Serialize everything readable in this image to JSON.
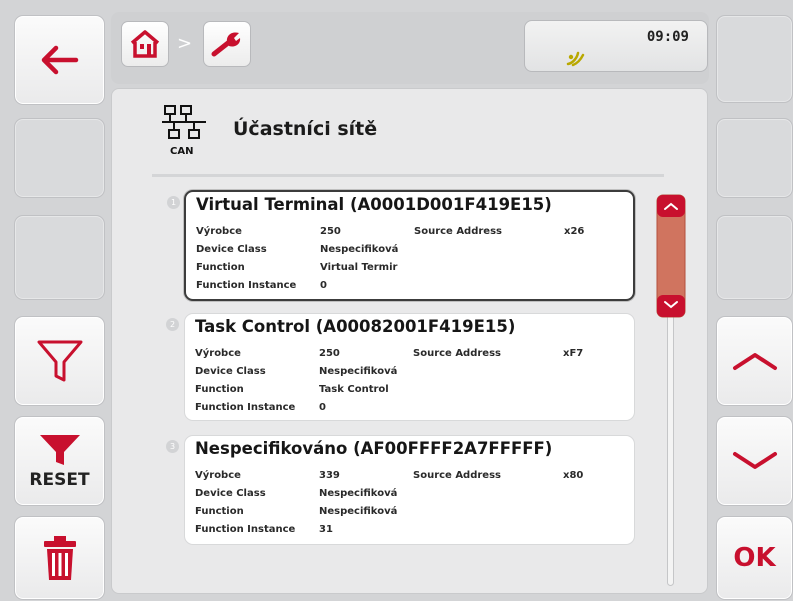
{
  "header": {
    "clock": "09:09",
    "breadcrumb_separator": ">"
  },
  "page": {
    "title": "Účastníci sítě",
    "icon_label": "CAN"
  },
  "softkeys_left": {
    "back": "back-arrow-icon",
    "filter": "filter-icon",
    "reset_label": "RESET",
    "delete": "trash-icon"
  },
  "softkeys_right": {
    "ok_label": "OK"
  },
  "entries": [
    {
      "index": "1",
      "title": "Virtual Terminal (A0001D001F419E15)",
      "rows": [
        {
          "label": "Výrobce",
          "value": "250",
          "label2": "Source Address",
          "value2": "x26"
        },
        {
          "label": "Device Class",
          "value": "Nespecifiková"
        },
        {
          "label": "Function",
          "value": "Virtual Termir"
        },
        {
          "label": "Function Instance",
          "value": "0"
        }
      ]
    },
    {
      "index": "2",
      "title": "Task Control (A00082001F419E15)",
      "rows": [
        {
          "label": "Výrobce",
          "value": "250",
          "label2": "Source Address",
          "value2": "xF7"
        },
        {
          "label": "Device Class",
          "value": "Nespecifiková"
        },
        {
          "label": "Function",
          "value": "Task Control"
        },
        {
          "label": "Function Instance",
          "value": "0"
        }
      ]
    },
    {
      "index": "3",
      "title": "Nespecifikováno (AF00FFFF2A7FFFFF)",
      "rows": [
        {
          "label": "Výrobce",
          "value": "339",
          "label2": "Source Address",
          "value2": "x80"
        },
        {
          "label": "Device Class",
          "value": "Nespecifiková"
        },
        {
          "label": "Function",
          "value": "Nespecifiková"
        },
        {
          "label": "Function Instance",
          "value": "31"
        }
      ]
    }
  ],
  "colors": {
    "accent_red": "#c8102e",
    "scroll_thumb": "#d0745f"
  }
}
